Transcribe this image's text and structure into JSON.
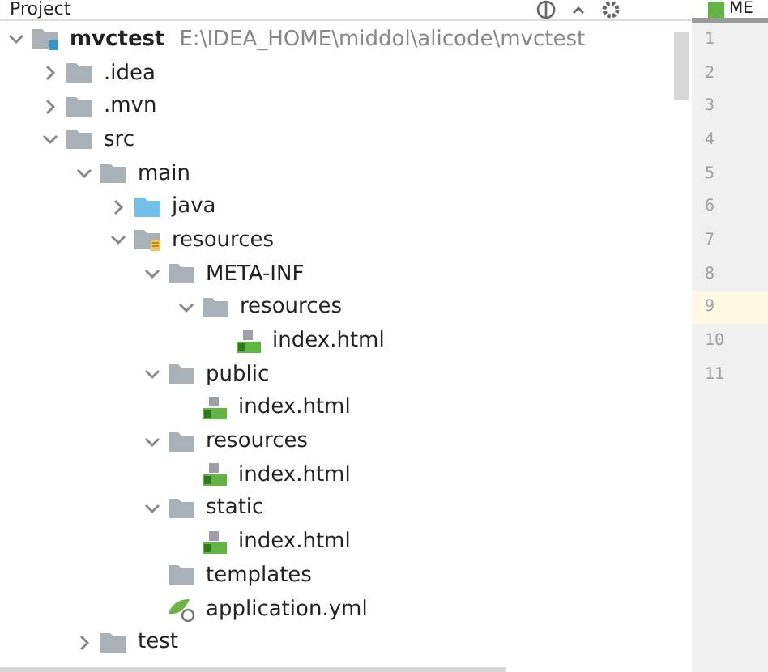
{
  "panel": {
    "title": "Project"
  },
  "tree": [
    {
      "kind": "module",
      "label": "mvctest",
      "path": "E:\\IDEA_HOME\\middol\\alicode\\mvctest",
      "expanded": true,
      "children": [
        {
          "kind": "folder",
          "label": ".idea",
          "expanded": false
        },
        {
          "kind": "folder",
          "label": ".mvn",
          "expanded": false
        },
        {
          "kind": "folder",
          "label": "src",
          "expanded": true,
          "children": [
            {
              "kind": "folder",
              "label": "main",
              "expanded": true,
              "children": [
                {
                  "kind": "source",
                  "label": "java",
                  "expanded": false
                },
                {
                  "kind": "res",
                  "label": "resources",
                  "expanded": true,
                  "children": [
                    {
                      "kind": "folder",
                      "label": "META-INF",
                      "expanded": true,
                      "children": [
                        {
                          "kind": "folder",
                          "label": "resources",
                          "expanded": true,
                          "children": [
                            {
                              "kind": "html",
                              "label": "index.html"
                            }
                          ]
                        }
                      ]
                    },
                    {
                      "kind": "folder",
                      "label": "public",
                      "expanded": true,
                      "children": [
                        {
                          "kind": "html",
                          "label": "index.html"
                        }
                      ]
                    },
                    {
                      "kind": "folder",
                      "label": "resources",
                      "expanded": true,
                      "children": [
                        {
                          "kind": "html",
                          "label": "index.html"
                        }
                      ]
                    },
                    {
                      "kind": "folder",
                      "label": "static",
                      "expanded": true,
                      "children": [
                        {
                          "kind": "html",
                          "label": "index.html"
                        }
                      ]
                    },
                    {
                      "kind": "folder",
                      "label": "templates"
                    },
                    {
                      "kind": "yml",
                      "label": "application.yml"
                    }
                  ]
                }
              ]
            },
            {
              "kind": "folder",
              "label": "test",
              "expanded": false
            }
          ]
        }
      ]
    }
  ],
  "editor": {
    "tab": "ME",
    "lines": [
      {
        "number": "1",
        "current": false
      },
      {
        "number": "2",
        "current": false
      },
      {
        "number": "3",
        "current": false
      },
      {
        "number": "4",
        "current": false
      },
      {
        "number": "5",
        "current": false
      },
      {
        "number": "6",
        "current": false
      },
      {
        "number": "7",
        "current": false
      },
      {
        "number": "8",
        "current": false
      },
      {
        "number": "9",
        "current": true
      },
      {
        "number": "10",
        "current": false
      },
      {
        "number": "11",
        "current": false
      }
    ]
  }
}
